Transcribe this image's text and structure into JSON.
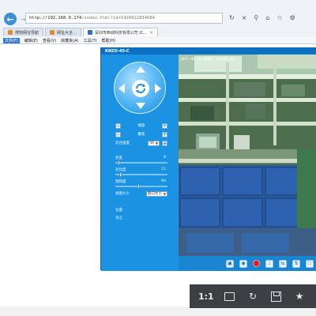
{
  "browser": {
    "address_host": "http://192.168.0.174",
    "address_path": "/index.html?id=1426022834084",
    "tabs": [
      {
        "label": "搜狗网址导航",
        "active": false
      },
      {
        "label": "网址大全...",
        "active": false
      },
      {
        "label": "深圳市西城科技有限公司 IC...",
        "active": true
      }
    ],
    "menu": [
      {
        "label": "文件(F)",
        "active": true
      },
      {
        "label": "编辑(E)",
        "active": false
      },
      {
        "label": "查看(V)",
        "active": false
      },
      {
        "label": "收藏夹(A)",
        "active": false
      },
      {
        "label": "工具(T)",
        "active": false
      },
      {
        "label": "帮助(H)",
        "active": false
      }
    ]
  },
  "app": {
    "title": "KNZD-45-C",
    "controls": {
      "zoom_label": "缩放",
      "focus_label": "聚焦",
      "speed_label": "云台速度",
      "speed_value": "50"
    },
    "sliders": [
      {
        "label": "亮度",
        "value": "8",
        "fraction": 0.05
      },
      {
        "label": "对比度",
        "value": "11",
        "fraction": 0.08
      },
      {
        "label": "饱和度",
        "value": "64",
        "fraction": 0.45
      }
    ],
    "resolution_label": "视窗大小",
    "resolution_value": "窗口大小",
    "settings_link": "设置",
    "language_link": "语言",
    "osd_timestamp": "2015-06-16 星期二 10:42:40"
  },
  "viewer_toolbar": {
    "actual_size": "1:1"
  },
  "colors": {
    "app_blue": "#1c8fe0",
    "title_blue": "#0d71c2",
    "record_red": "#d51f2a"
  }
}
